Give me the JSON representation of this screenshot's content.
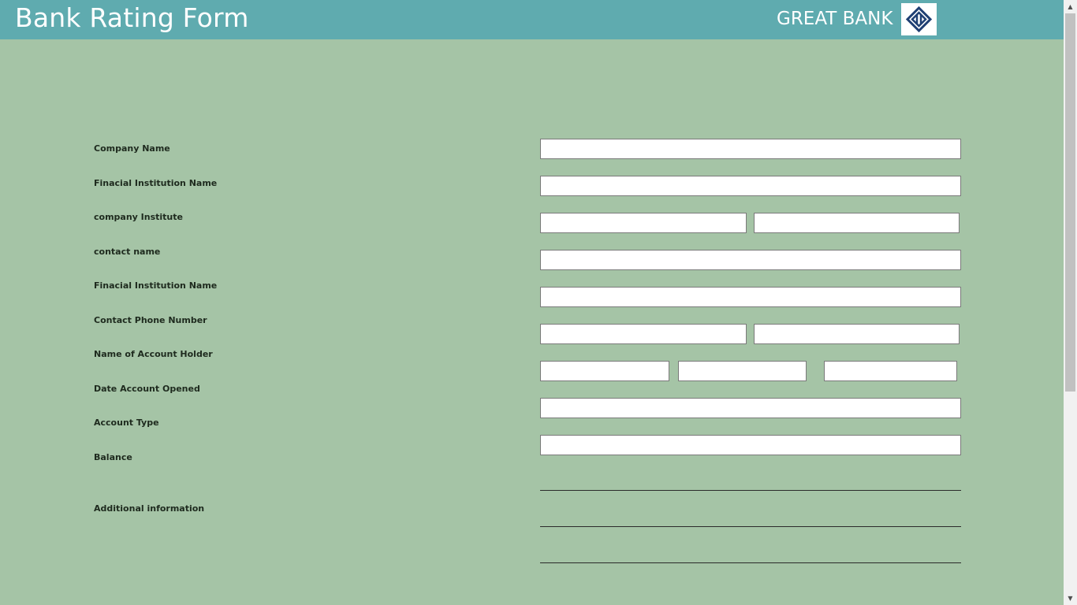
{
  "header": {
    "title": "Bank Rating Form",
    "brand_name": "GREAT BANK",
    "logo_icon": "diamond-logo-icon",
    "background_color": "#5fabaf"
  },
  "page": {
    "background_color": "#a5c4a6"
  },
  "form": {
    "labels": {
      "company_name": "Company Name",
      "financial_institution_name_1": "Finacial Institution Name",
      "company_institute": "company Institute",
      "contact_name": "contact name",
      "financial_institution_name_2": "Finacial Institution Name",
      "contact_phone_number": "Contact Phone Number",
      "name_of_account_holder": "Name of Account Holder",
      "date_account_opened": "Date Account Opened",
      "account_type": "Account Type",
      "balance": "Balance",
      "additional_information": "Additional information"
    },
    "values": {
      "company_name": "",
      "financial_institution_name_1": "",
      "company_institute_1": "",
      "company_institute_2": "",
      "contact_name": "",
      "financial_institution_name_2": "",
      "contact_phone_1": "",
      "contact_phone_2": "",
      "account_holder_1": "",
      "account_holder_2": "",
      "account_holder_3": "",
      "date_account_opened": "",
      "account_type": ""
    }
  },
  "scrollbar": {
    "up_icon": "scroll-up-arrow-icon",
    "down_icon": "scroll-down-arrow-icon"
  }
}
